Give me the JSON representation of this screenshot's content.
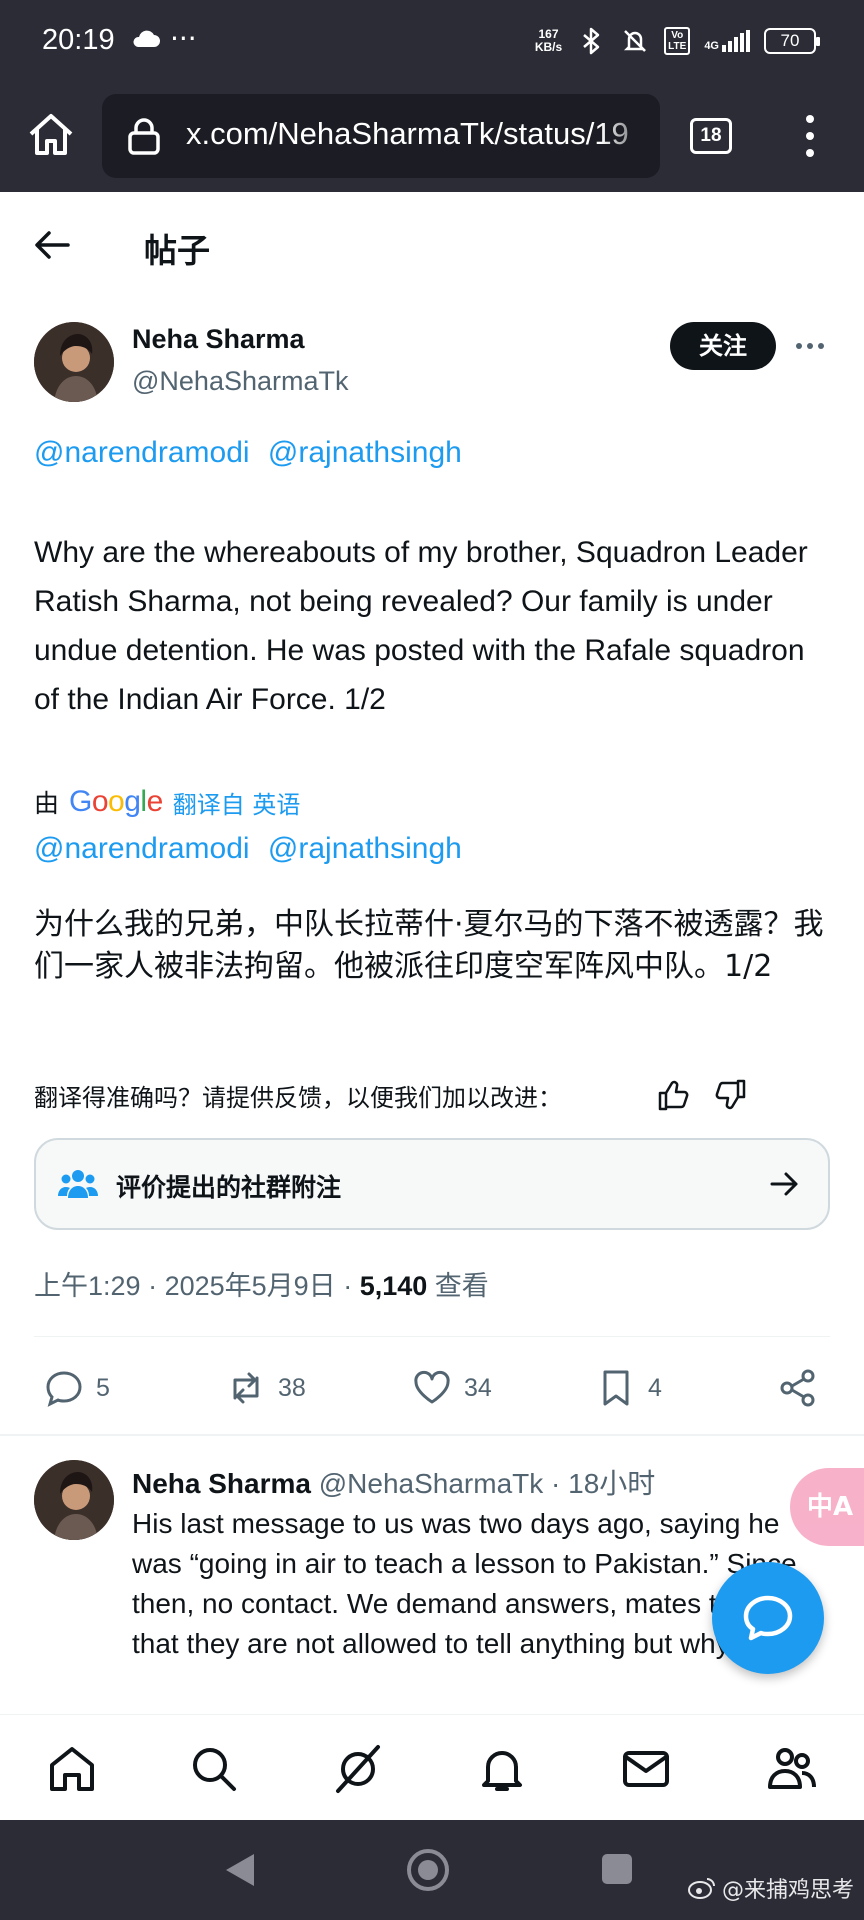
{
  "status_bar": {
    "time": "20:19",
    "speed_value": "167",
    "speed_unit": "KB/s",
    "volte_top": "Vo",
    "volte_bottom": "LTE",
    "network": "4G",
    "battery": "70",
    "icons": [
      "cloud-icon",
      "more-dots-icon",
      "bluetooth-icon",
      "mute-icon",
      "volte-icon",
      "signal-icon",
      "battery-icon"
    ]
  },
  "browser": {
    "url": "x.com/NehaSharmaTk/status/19",
    "tab_count": "18"
  },
  "header": {
    "title": "帖子"
  },
  "post": {
    "author_name": "Neha Sharma",
    "author_handle": "@NehaSharmaTk",
    "follow_label": "关注",
    "mentions": [
      "@narendramodi",
      "@rajnathsingh"
    ],
    "body_en": "Why are the whereabouts of my brother, Squadron Leader Ratish Sharma, not being revealed? Our family is under undue detention. He was posted with the Rafale squadron of the Indian Air Force. 1/2",
    "translated_by_prefix": "由",
    "translator": "Google",
    "translated_from": "翻译自 英语",
    "mentions_translated": [
      "@narendramodi",
      "@rajnathsingh"
    ],
    "body_zh": "为什么我的兄弟，中队长拉蒂什·夏尔马的下落不被透露？我们一家人被非法拘留。他被派往印度空军阵风中队。1/2",
    "feedback_prompt": "翻译得准确吗？请提供反馈，以便我们加以改进：",
    "community_note_label": "评价提出的社群附注",
    "time": "上午1:29",
    "date": "2025年5月9日",
    "views": "5,140",
    "views_label": "查看",
    "replies": "5",
    "reposts": "38",
    "likes": "34",
    "bookmarks": "4"
  },
  "reply": {
    "author_name": "Neha Sharma",
    "meta": "@NehaSharmaTk · 18小时",
    "text": "His last message to us was two days ago, saying he was “going in air to teach a lesson to Pakistan.” Since then, no contact. We demand answers, mates telling us that they are not allowed to tell anything but why ?"
  },
  "floating_translate": "中A",
  "watermark": "@来捕鸡思考",
  "colors": {
    "accent": "#1d9bf0",
    "text": "#0f1419",
    "secondary": "#536471",
    "chrome": "#2b2c36"
  }
}
